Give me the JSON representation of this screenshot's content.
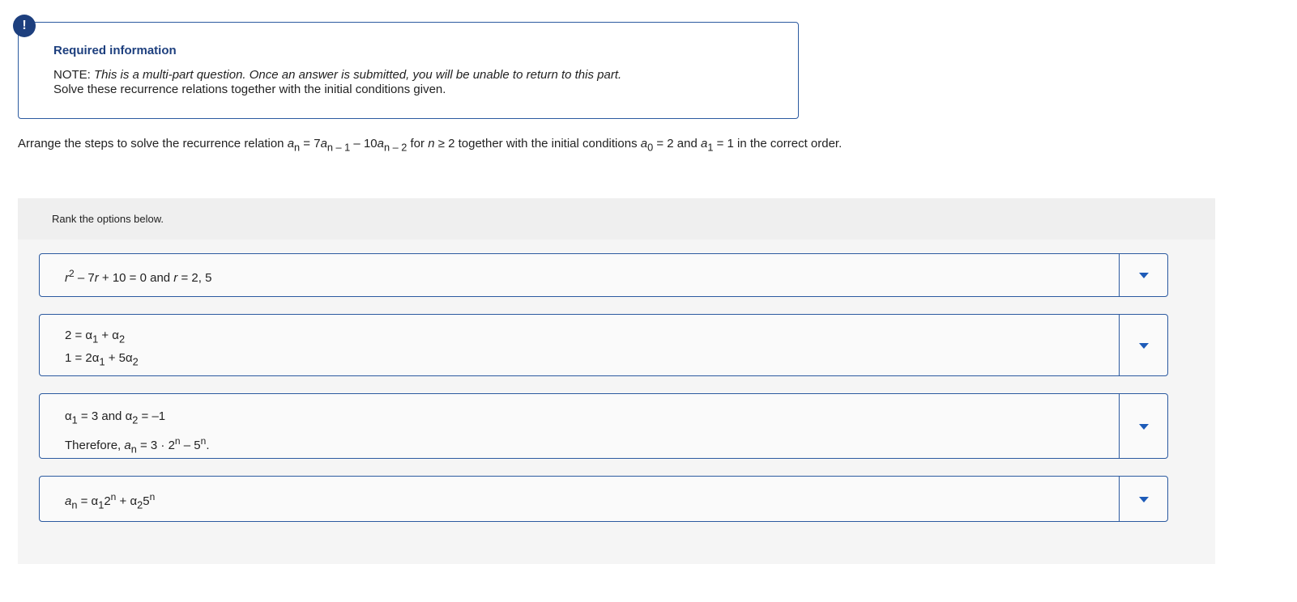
{
  "required": {
    "badge": "!",
    "title": "Required information",
    "note_prefix": "NOTE: ",
    "note_italic": "This is a multi-part question. Once an answer is submitted, you will be unable to return to this part.",
    "instruction": "Solve these recurrence relations together with the initial conditions given."
  },
  "question": {
    "t1": "Arrange the steps to solve the recurrence relation ",
    "an": "a",
    "an_sub": "n",
    "eq1": " = 7",
    "a2": "a",
    "a2_sub": "n – 1",
    "minus": " – 10",
    "a3": "a",
    "a3_sub": "n – 2",
    "t2": " for ",
    "n": "n",
    "t3": " ≥ 2 together with the initial conditions ",
    "a0": "a",
    "a0_sub": "0",
    "t4": " = 2 and ",
    "a1": "a",
    "a1_sub": "1",
    "t5": " = 1 in the correct order."
  },
  "rank": {
    "label": "Rank the options below.",
    "items": [
      {
        "r": "r",
        "r_sup": "2",
        "rest": " – 7",
        "r2": "r",
        "rest2": " + 10 = 0 and ",
        "r3": "r",
        "rest3": " = 2, 5"
      },
      {
        "line1_a": "2 = α",
        "line1_s1": "1",
        "line1_b": " + α",
        "line1_s2": "2",
        "line2_a": "1 = 2α",
        "line2_s1": "1",
        "line2_b": " + 5α",
        "line2_s2": "2"
      },
      {
        "line1_a": "α",
        "line1_s1": "1",
        "line1_b": " = 3 and α",
        "line1_s2": "2",
        "line1_c": " = –1",
        "line2_a": "Therefore, ",
        "line2_an": "a",
        "line2_an_sub": "n",
        "line2_b": " = 3 · 2",
        "line2_sup1": "n",
        "line2_c": " – 5",
        "line2_sup2": "n",
        "line2_d": "."
      },
      {
        "an": "a",
        "an_sub": "n",
        "b": " = α",
        "s1": "1",
        "c": "2",
        "sup1": "n",
        "d": " + α",
        "s2": "2",
        "e": "5",
        "sup2": "n"
      }
    ]
  },
  "icons": {
    "caret": "caret-down-icon"
  },
  "colors": {
    "brand": "#1d3f7e",
    "border": "#2c5aa0",
    "caret": "#1d5bb8",
    "panel": "#f5f5f5"
  }
}
